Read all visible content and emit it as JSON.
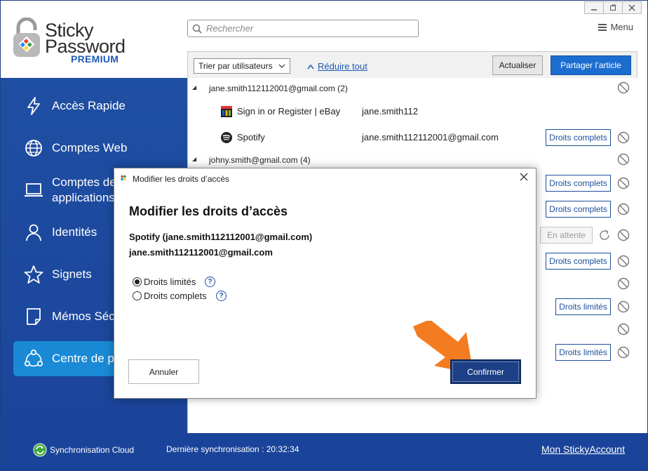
{
  "window": {
    "controls": [
      "minimize",
      "restore",
      "close"
    ]
  },
  "logo": {
    "line1": "Sticky",
    "line2": "Password",
    "line3": "PREMIUM",
    "brand_color": "#1d5bb5"
  },
  "search": {
    "placeholder": "Rechercher"
  },
  "menu": {
    "label": "Menu"
  },
  "sidebar": {
    "items": [
      {
        "label": "Accès Rapide",
        "icon": "lightning-icon"
      },
      {
        "label": "Comptes Web",
        "icon": "globe-icon"
      },
      {
        "label_line1": "Comptes de",
        "label_line2": "applications",
        "icon": "laptop-icon"
      },
      {
        "label": "Identités",
        "icon": "person-icon"
      },
      {
        "label": "Signets",
        "icon": "star-icon"
      },
      {
        "label": "Mémos Séc",
        "icon": "note-icon"
      },
      {
        "label": "Centre de p",
        "icon": "share-icon",
        "active": true
      }
    ]
  },
  "toolbar": {
    "sort_value": "Trier par utilisateurs",
    "collapse_label": "Réduire tout",
    "refresh_label": "Actualiser",
    "share_label": "Partager l’article"
  },
  "list": {
    "group1": "jane.smith112112001@gmail.com (2)",
    "item1_name": "Sign in or Register | eBay",
    "item1_user": "jane.smith112",
    "item2_name": "Spotify",
    "item2_user": "jane.smith112112001@gmail.com",
    "group2": "johny.smith@gmail.com (4)",
    "full_rights": "Droits complets",
    "limited_rights": "Droits limités",
    "pending": "En attente"
  },
  "dialog": {
    "title": "Modifier les droits d’accès",
    "heading": "Modifier les droits d’accès",
    "line1": "Spotify (jane.smith112112001@gmail.com)",
    "line2": "jane.smith112112001@gmail.com",
    "option_limited": "Droits limités",
    "option_full": "Droits complets",
    "selected": "Droits limités",
    "help": "?",
    "cancel_label": "Annuler",
    "confirm_label": "Confirmer"
  },
  "footer": {
    "sync_label": "Synchronisation Cloud",
    "last_sync": "Dernière synchronisation : 20:32:34",
    "account_link": "Mon StickyAccount"
  },
  "colors": {
    "sidebar": "#1f4fa3",
    "active_item": "#1a8ad6",
    "primary_button": "#1c6dd0",
    "arrow": "#f47c20"
  }
}
